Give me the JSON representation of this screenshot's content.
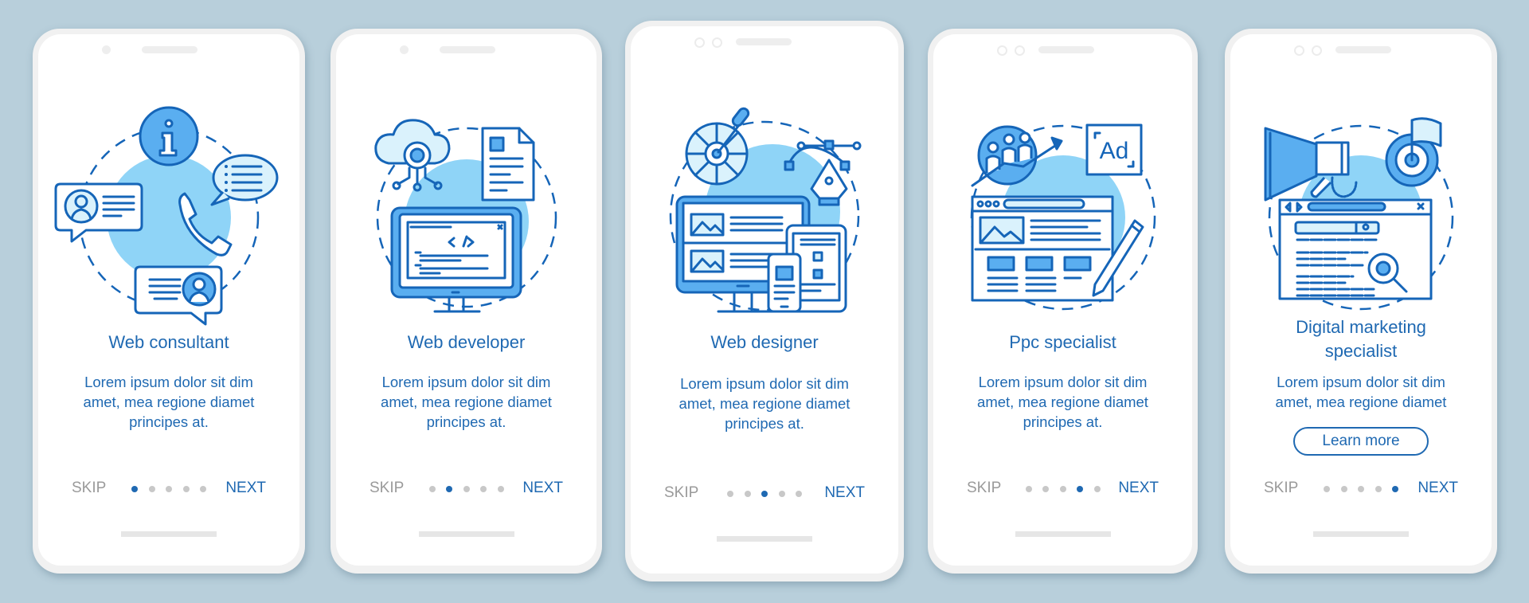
{
  "colors": {
    "background": "#b8cfdb",
    "accent": "#1f69b2",
    "icon_stroke": "#1565b8",
    "icon_fill": "#5aaef0",
    "icon_halo": "#8fd4f7",
    "icon_pale": "#daf2fc",
    "muted": "#9a9a9a",
    "dot_inactive": "#c8c8c8"
  },
  "nav": {
    "skip_label": "SKIP",
    "next_label": "NEXT",
    "total_steps": 5
  },
  "screens": [
    {
      "title": "Web consultant",
      "body": [
        "Lorem ipsum dolor sit dim",
        "amet, mea regione diamet",
        "principes at."
      ],
      "active_step": 1,
      "illustration": "web-consultant-illustration"
    },
    {
      "title": "Web developer",
      "body": [
        "Lorem ipsum dolor sit dim",
        "amet, mea regione diamet",
        "principes at."
      ],
      "active_step": 2,
      "illustration": "web-developer-illustration"
    },
    {
      "title": "Web designer",
      "body": [
        "Lorem ipsum dolor sit dim",
        "amet, mea regione diamet",
        "principes at."
      ],
      "active_step": 3,
      "illustration": "web-designer-illustration"
    },
    {
      "title": "Ppc specialist",
      "body": [
        "Lorem ipsum dolor sit dim",
        "amet, mea regione diamet",
        "principes at."
      ],
      "active_step": 4,
      "illustration": "ppc-specialist-illustration"
    },
    {
      "title": [
        "Digital marketing",
        "specialist"
      ],
      "body": [
        "Lorem ipsum dolor sit dim",
        "amet, mea regione diamet"
      ],
      "active_step": 5,
      "button_label": "Learn more",
      "illustration": "digital-marketing-illustration"
    }
  ],
  "icons": {
    "screen1": [
      "info-icon",
      "chat-profile-icon",
      "phone-call-icon",
      "list-speech-bubble-icon"
    ],
    "screen2": [
      "cloud-gear-icon",
      "document-icon",
      "monitor-code-icon"
    ],
    "screen3": [
      "color-wheel-icon",
      "eyedropper-icon",
      "pen-tool-icon",
      "monitor-icon",
      "tablet-icon",
      "smartphone-icon"
    ],
    "screen4": [
      "audience-growth-icon",
      "ad-icon",
      "webpage-layout-icon",
      "pencil-icon"
    ],
    "screen5": [
      "megaphone-icon",
      "target-flag-icon",
      "browser-search-icon",
      "magnifier-gear-icon"
    ]
  }
}
